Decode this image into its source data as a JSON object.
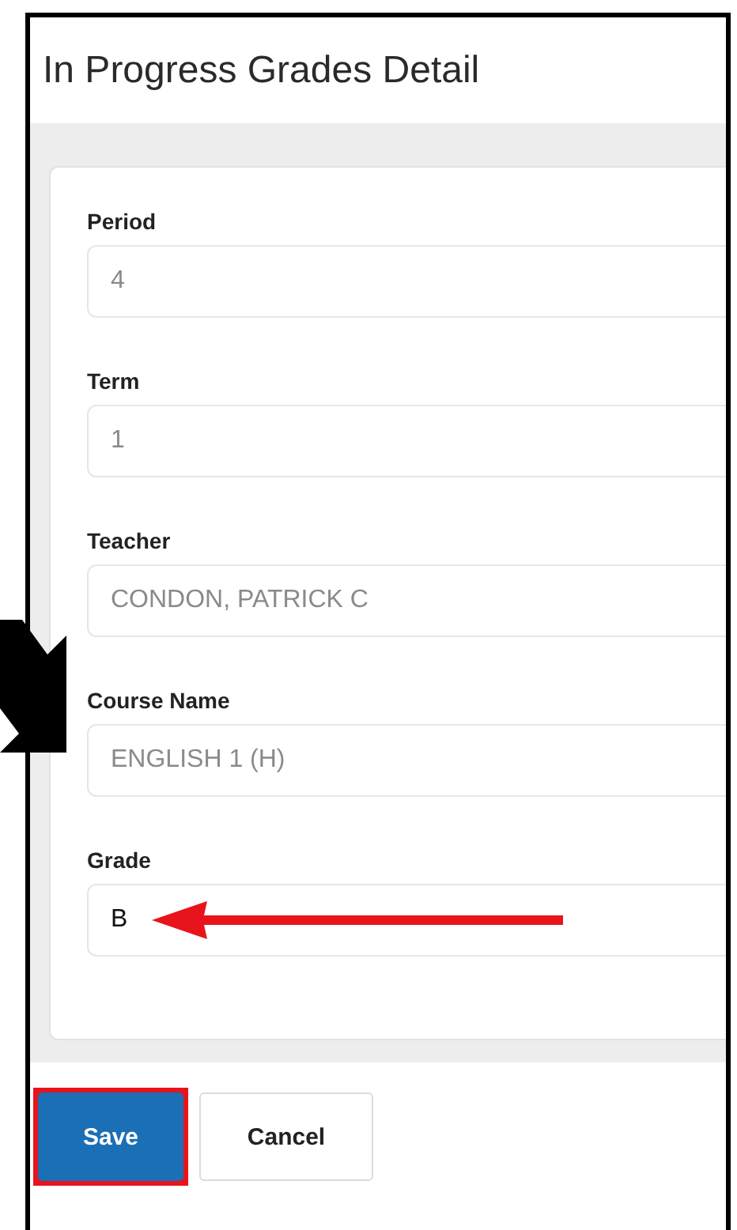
{
  "window": {
    "title": "In Progress Grades Detail"
  },
  "fields": [
    {
      "label": "Period",
      "value": "4",
      "disabled": true
    },
    {
      "label": "Term",
      "value": "1",
      "disabled": true
    },
    {
      "label": "Teacher",
      "value": "CONDON, PATRICK C",
      "disabled": true
    },
    {
      "label": "Course Name",
      "value": "ENGLISH 1 (H)",
      "disabled": true
    },
    {
      "label": "Grade",
      "value": "B",
      "disabled": false
    }
  ],
  "buttons": [
    {
      "label": "Save",
      "kind": "primary",
      "highlighted": true
    },
    {
      "label": "Cancel",
      "kind": "secondary",
      "highlighted": false
    }
  ]
}
